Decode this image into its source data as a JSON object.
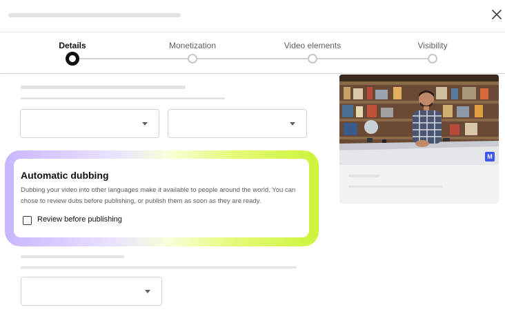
{
  "dialog": {
    "close_icon": "close-icon"
  },
  "stepper": {
    "steps": [
      {
        "label": "Details",
        "active": true
      },
      {
        "label": "Monetization",
        "active": false
      },
      {
        "label": "Video elements",
        "active": false
      },
      {
        "label": "Visibility",
        "active": false
      }
    ]
  },
  "dubbing": {
    "title": "Automatic dubbing",
    "description": "Dubbing your video into other languages make it available to people around the world. You can chose to review dubs before publishing, or publish them as soon as they are ready.",
    "checkbox_label": "Review before publishing",
    "checkbox_checked": false
  },
  "preview": {
    "badge_text": "M"
  },
  "colors": {
    "highlight_start": "#c9b6ff",
    "highlight_end": "#cdf43a",
    "active_step": "#0f0f0f",
    "badge": "#3d57f2"
  }
}
